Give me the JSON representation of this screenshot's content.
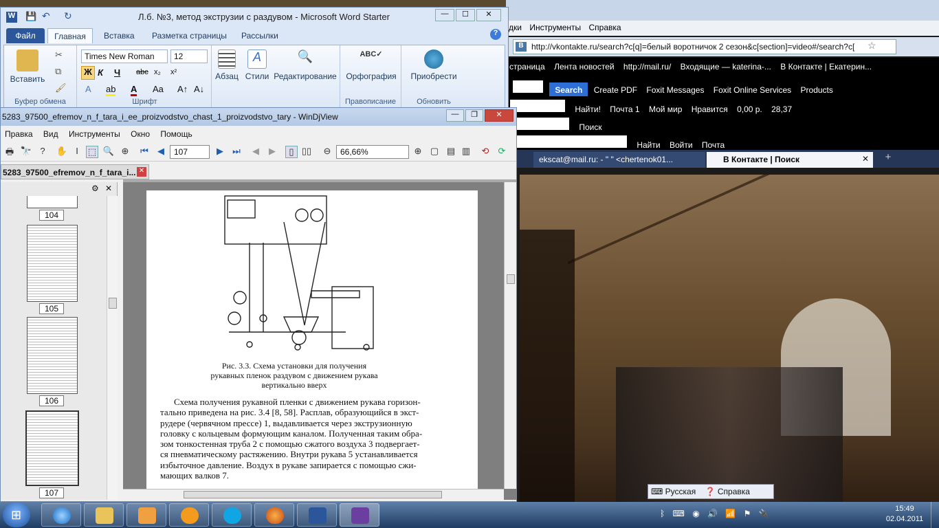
{
  "browser": {
    "menu": [
      "дки",
      "Инструменты",
      "Справка"
    ],
    "url": "http://vkontakte.ru/search?c[q]=белый воротничок 2 сезон&c[section]=video#/search?c[",
    "bookmarks": [
      "страница",
      "Лента новостей",
      "http://mail.ru/",
      "Входящие — katerina-...",
      "В Контакте | Екатерин..."
    ],
    "toolbar2": [
      "Search",
      "Create PDF",
      "Foxit Messages",
      "Foxit Online Services",
      "Products"
    ],
    "toolbar3": [
      "Найти!",
      "Почта 1",
      "Мой мир",
      "Нравится",
      "0,00 р.",
      "28,37"
    ],
    "toolbar4": [
      "Поиск"
    ],
    "toolbar5": [
      "Найти",
      "Войти",
      "Почта"
    ],
    "tabs": [
      "ekscat@mail.ru: - \" \" <chertenok01...",
      "В Контакте | Поиск"
    ],
    "language_bar": {
      "lang": "Русская",
      "help": "Справка"
    }
  },
  "word": {
    "title": "Л.б. №3, метод экструзии с раздувом - Microsoft Word Starter",
    "tabs": [
      "Файл",
      "Главная",
      "Вставка",
      "Разметка страницы",
      "Рассылки"
    ],
    "font_name": "Times New Roman",
    "font_size": "12",
    "buttons": {
      "paste": "Вставить",
      "paragraph": "Абзац",
      "styles": "Стили",
      "editing": "Редактирование",
      "spelling": "Орфография",
      "apps": "Приобрести"
    },
    "groups": [
      "Буфер обмена",
      "Шрифт",
      "Правописание",
      "Обновить"
    ]
  },
  "djview": {
    "title": "5283_97500_efremov_n_f_tara_i_ee_proizvodstvo_chast_1_proizvodstvo_tary - WinDjView",
    "menu": [
      "Правка",
      "Вид",
      "Инструменты",
      "Окно",
      "Помощь"
    ],
    "page": "107",
    "zoom": "66,66%",
    "doc_tab": "5283_97500_efremov_n_f_tara_i...",
    "thumb_pages": [
      "104",
      "105",
      "106",
      "107"
    ],
    "caption": "Рис. 3.3. Схема установки для получения рукавных пленок раздувом с движением рукава вертикально вверх",
    "paragraph": [
      "Схема получения рукавной пленки с движением рукава горизон-",
      "тально приведена на рис. 3.4 [8, 58]. Расплав, образующийся в экст-",
      "рудере (червячном прессе) 1, выдавливается через экструзионную",
      "головку с кольцевым формующим каналом. Полученная таким обра-",
      "зом тонкостенная труба 2 с помощью сжатого воздуха 3 подвергает-",
      "ся пневматическому растяжению. Внутри рукава 5 устанавливается",
      "избыточное давление. Воздух в рукаве запирается с помощью сжи-",
      "мающих валков 7."
    ]
  },
  "taskbar": {
    "time": "15:49",
    "date": "02.04.2011"
  }
}
